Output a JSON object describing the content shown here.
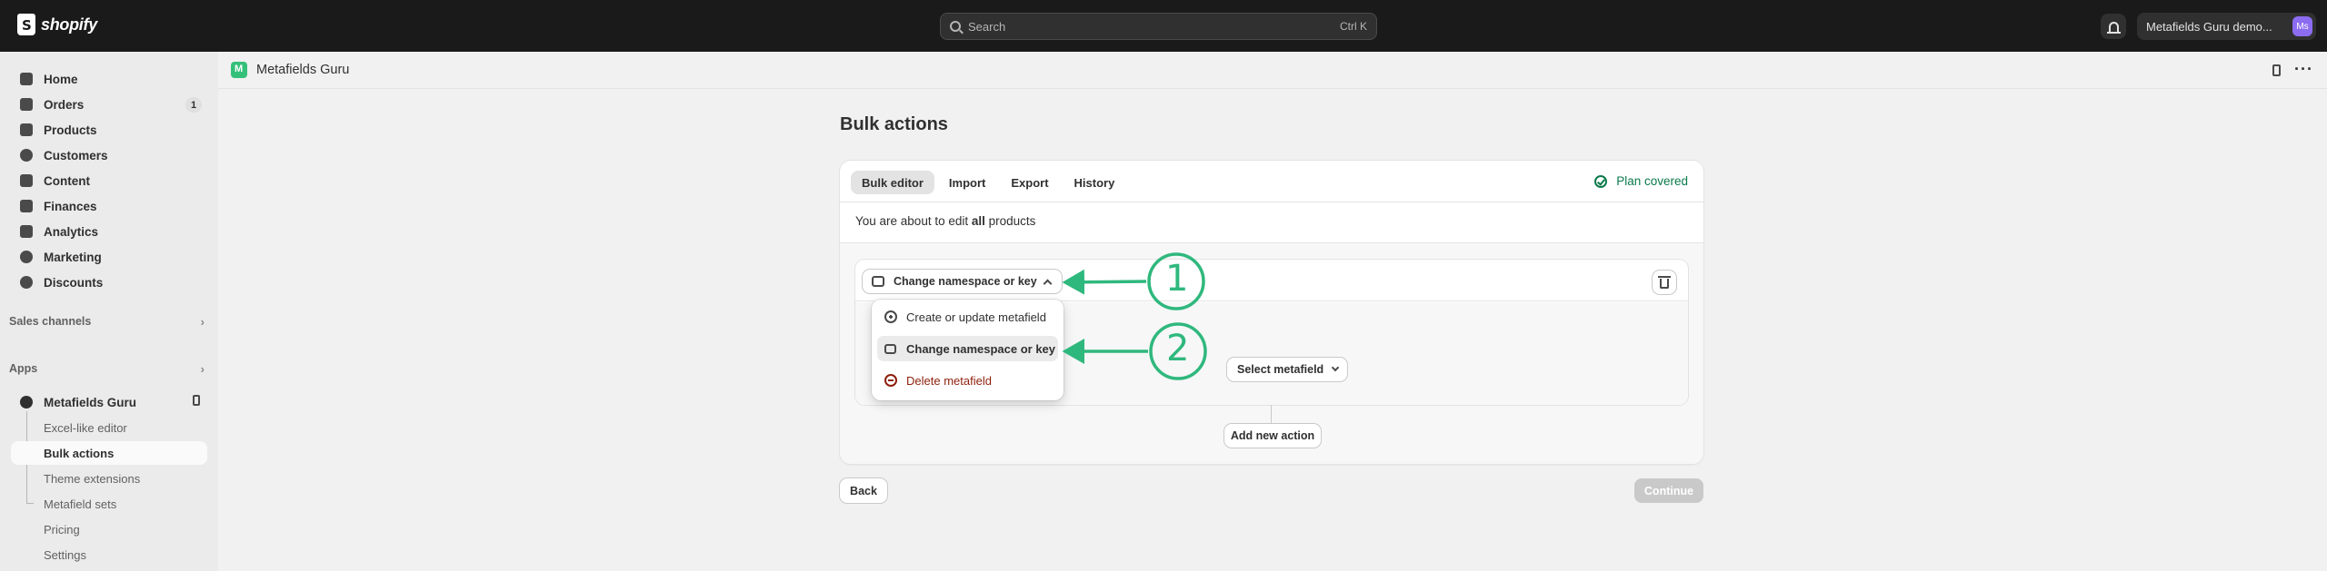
{
  "topbar": {
    "brand": "shopify",
    "search_placeholder": "Search",
    "search_shortcut": "Ctrl K",
    "store_name": "Metafields Guru demo...",
    "avatar_initials": "Ms"
  },
  "sidebar": {
    "items": [
      {
        "label": "Home",
        "icon": "home-icon"
      },
      {
        "label": "Orders",
        "icon": "orders-icon",
        "badge": "1"
      },
      {
        "label": "Products",
        "icon": "tag-icon"
      },
      {
        "label": "Customers",
        "icon": "person-icon"
      },
      {
        "label": "Content",
        "icon": "content-icon"
      },
      {
        "label": "Finances",
        "icon": "bank-icon"
      },
      {
        "label": "Analytics",
        "icon": "chart-icon"
      },
      {
        "label": "Marketing",
        "icon": "target-icon"
      },
      {
        "label": "Discounts",
        "icon": "discount-icon"
      }
    ],
    "sales_channels": "Sales channels",
    "apps": "Apps",
    "app_name": "Metafields Guru",
    "app_subitems": [
      "Excel-like editor",
      "Bulk actions",
      "Theme extensions",
      "Metafield sets",
      "Pricing",
      "Settings"
    ],
    "active_subitem": "Bulk actions"
  },
  "app_header": {
    "title": "Metafields Guru"
  },
  "page": {
    "title": "Bulk actions",
    "tabs": [
      "Bulk editor",
      "Import",
      "Export",
      "History"
    ],
    "active_tab": "Bulk editor",
    "plan_status": "Plan covered",
    "edit_prefix": "You are about to edit",
    "edit_scope": "all",
    "edit_suffix": "products",
    "action_button": "Change namespace or key",
    "select_metafield": "Select metafield",
    "dropdown": [
      {
        "label": "Create or update metafield",
        "icon": "plus-circle-icon"
      },
      {
        "label": "Change namespace or key",
        "icon": "swap-icon",
        "selected": true
      },
      {
        "label": "Delete metafield",
        "icon": "minus-circle-icon",
        "danger": true
      }
    ],
    "add_action": "Add new action",
    "back": "Back",
    "continue": "Continue"
  },
  "annotations": [
    "1",
    "2"
  ],
  "colors": {
    "accent_green": "#2fb87d",
    "success": "#0b7a4b",
    "danger": "#8e1f0b",
    "topbar": "#1a1a1a"
  }
}
